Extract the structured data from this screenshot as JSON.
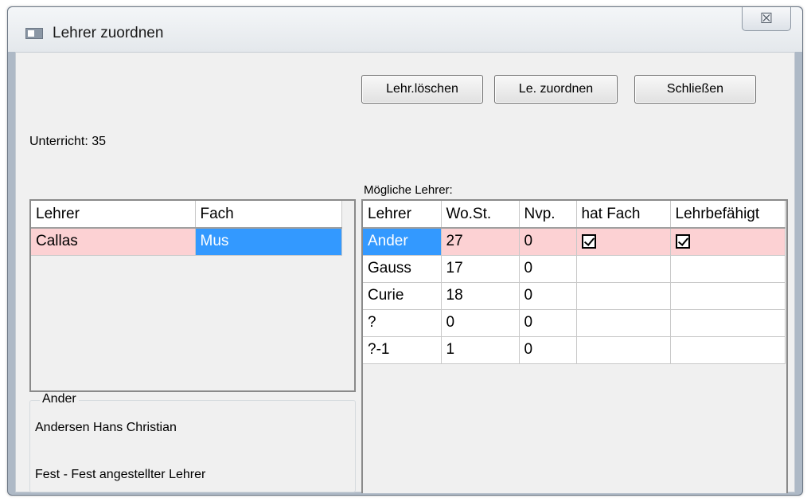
{
  "window": {
    "title": "Lehrer zuordnen",
    "close_glyph": "☒"
  },
  "toolbar": {
    "delete_label": "Lehr.löschen",
    "assign_label": "Le. zuordnen",
    "close_label": "Schließen"
  },
  "unterricht_label": "Unterricht: 35",
  "moegliche_label": "Mögliche Lehrer:",
  "assigned": {
    "headers": [
      "Lehrer",
      "Fach"
    ],
    "rows": [
      [
        "Callas",
        "Mus"
      ]
    ]
  },
  "candidates": {
    "headers": [
      "Lehrer",
      "Wo.St.",
      "Nvp.",
      "hat Fach",
      "Lehrbefähigt"
    ],
    "rows": [
      [
        "Ander",
        "27",
        "0",
        true,
        true
      ],
      [
        "Gauss",
        "17",
        "0",
        false,
        false
      ],
      [
        "Curie",
        "18",
        "0",
        false,
        false
      ],
      [
        "?",
        "0",
        "0",
        false,
        false
      ],
      [
        "?-1",
        "1",
        "0",
        false,
        false
      ]
    ]
  },
  "details": {
    "legend": "Ander",
    "fullname": "Andersen Hans Christian",
    "status": "Fest - Fest angestellter Lehrer"
  },
  "colors": {
    "selected_row": "#fcd1d3",
    "selected_cell": "#3399ff"
  }
}
